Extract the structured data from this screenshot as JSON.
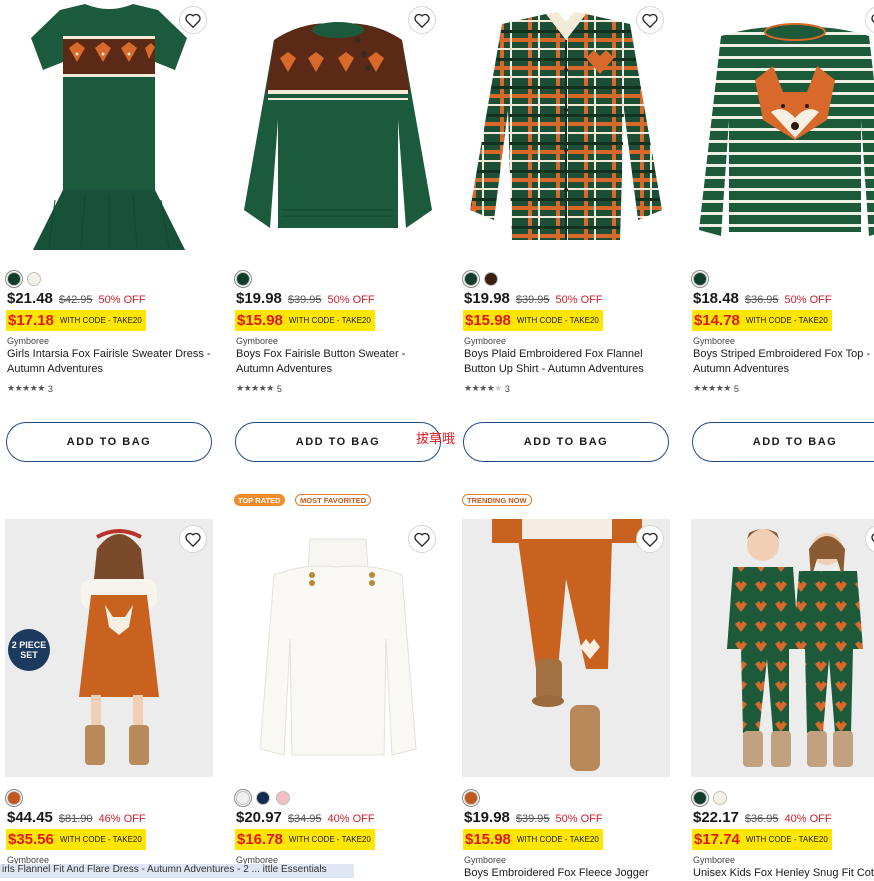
{
  "products": [
    {
      "badges": [],
      "swatches": [
        "#123d2a",
        "#f3f0e6"
      ],
      "price": "$21.48",
      "original": "$42.95",
      "discount": "50% OFF",
      "promo_price": "$17.18",
      "promo_code": "WITH CODE - TAKE20",
      "brand": "Gymboree",
      "name": "Girls Intarsia Fox Fairisle Sweater Dress - Autumn Adventures",
      "rating": 5,
      "reviews": "3",
      "button": "ADD TO BAG"
    },
    {
      "badges": [],
      "swatches": [
        "#123d2a"
      ],
      "price": "$19.98",
      "original": "$39.95",
      "discount": "50% OFF",
      "promo_price": "$15.98",
      "promo_code": "WITH CODE - TAKE20",
      "brand": "Gymboree",
      "name": "Boys Fox Fairisle Button Sweater - Autumn Adventures",
      "rating": 5,
      "reviews": "5",
      "button": "ADD TO BAG"
    },
    {
      "badges": [],
      "swatches": [
        "#123d2a",
        "#3d1f12"
      ],
      "price": "$19.98",
      "original": "$39.95",
      "discount": "50% OFF",
      "promo_price": "$15.98",
      "promo_code": "WITH CODE - TAKE20",
      "brand": "Gymboree",
      "name": "Boys Plaid Embroidered Fox Flannel Button Up Shirt - Autumn Adventures",
      "rating": 4,
      "reviews": "3",
      "button": "ADD TO BAG"
    },
    {
      "badges": [],
      "swatches": [
        "#123d2a"
      ],
      "price": "$18.48",
      "original": "$36.95",
      "discount": "50% OFF",
      "promo_price": "$14.78",
      "promo_code": "WITH CODE - TAKE20",
      "brand": "Gymboree",
      "name": "Boys Striped Embroidered Fox Top - Autumn Adventures",
      "rating": 5,
      "reviews": "5",
      "button": "ADD TO BAG"
    },
    {
      "badges": [],
      "set_badge": "2 PIECE SET",
      "swatches": [
        "#c1581f"
      ],
      "price": "$44.45",
      "original": "$81.90",
      "discount": "46% OFF",
      "promo_price": "$35.56",
      "promo_code": "WITH CODE - TAKE20",
      "brand": "Gymboree",
      "name": "",
      "rating": 0,
      "reviews": "",
      "button": ""
    },
    {
      "badges": [
        {
          "text": "TOP RATED",
          "style": "solid"
        },
        {
          "text": "MOST FAVORITED",
          "style": "outline"
        }
      ],
      "swatches": [
        "#efefef",
        "#142a4e",
        "#f2c0c4"
      ],
      "price": "$20.97",
      "original": "$34.95",
      "discount": "40% OFF",
      "promo_price": "$16.78",
      "promo_code": "WITH CODE - TAKE20",
      "brand": "Gymboree",
      "name": "",
      "rating": 0,
      "reviews": "",
      "button": ""
    },
    {
      "badges": [
        {
          "text": "TRENDING NOW",
          "style": "outline"
        }
      ],
      "swatches": [
        "#c1581f"
      ],
      "price": "$19.98",
      "original": "$39.95",
      "discount": "50% OFF",
      "promo_price": "$15.98",
      "promo_code": "WITH CODE - TAKE20",
      "brand": "Gymboree",
      "name": "Boys Embroidered Fox Fleece Jogger",
      "rating": 0,
      "reviews": "",
      "button": ""
    },
    {
      "badges": [],
      "swatches": [
        "#123d2a",
        "#f3f0e6"
      ],
      "price": "$22.17",
      "original": "$36.95",
      "discount": "40% OFF",
      "promo_price": "$17.74",
      "promo_code": "WITH CODE - TAKE20",
      "brand": "Gymboree",
      "name": "Unisex Kids Fox Henley Snug Fit Cotton",
      "rating": 0,
      "reviews": "",
      "button": ""
    }
  ],
  "overlay_text": "拔草哦",
  "tooltip_text": "irls Flannel Fit And Flare Dress - Autumn Adventures - 2 ...                  ittle Essentials"
}
